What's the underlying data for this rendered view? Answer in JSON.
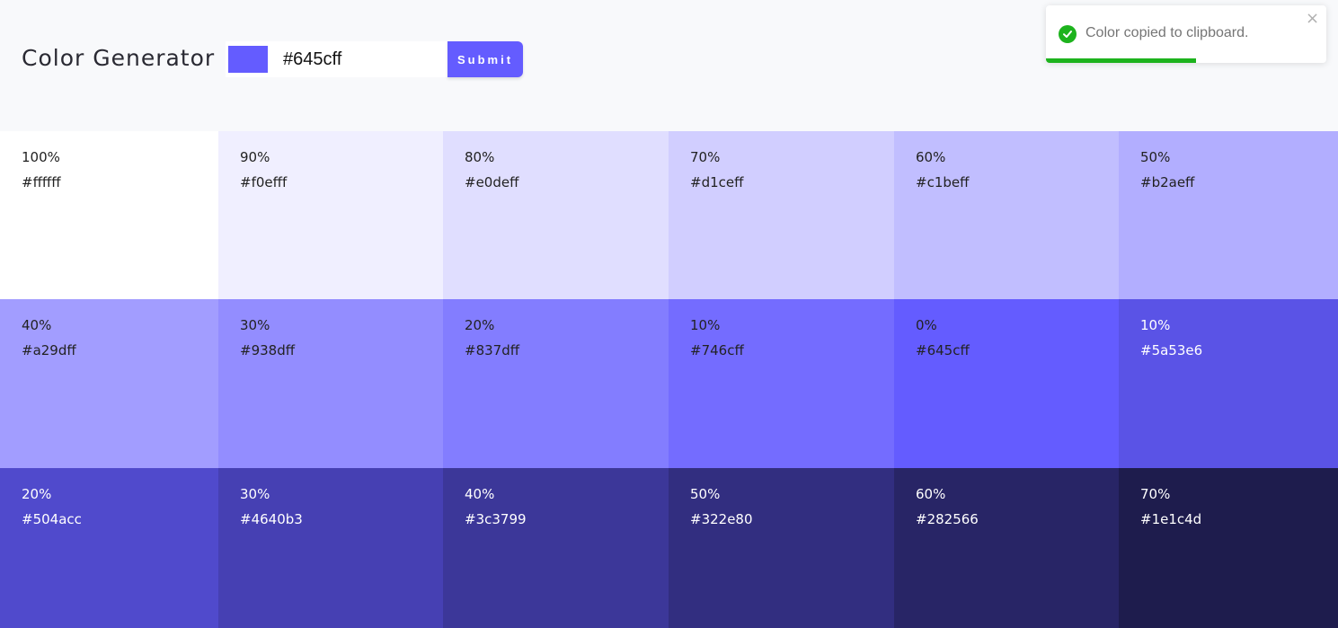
{
  "header": {
    "title": "Color Generator",
    "picker_color": "#645cff",
    "input_value": "#645cff",
    "submit_label": "Submit",
    "accent_color": "#645cff"
  },
  "toast": {
    "message": "Color copied to clipboard.",
    "icon": "check-circle-icon",
    "close_glyph": "×",
    "success_color": "#1db31d",
    "progress_fraction": 0.535
  },
  "colors": [
    {
      "percent": "100%",
      "hex": "#ffffff"
    },
    {
      "percent": "90%",
      "hex": "#f0efff"
    },
    {
      "percent": "80%",
      "hex": "#e0deff"
    },
    {
      "percent": "70%",
      "hex": "#d1ceff"
    },
    {
      "percent": "60%",
      "hex": "#c1beff"
    },
    {
      "percent": "50%",
      "hex": "#b2aeff"
    },
    {
      "percent": "40%",
      "hex": "#a29dff"
    },
    {
      "percent": "30%",
      "hex": "#938dff"
    },
    {
      "percent": "20%",
      "hex": "#837dff"
    },
    {
      "percent": "10%",
      "hex": "#746cff"
    },
    {
      "percent": "0%",
      "hex": "#645cff"
    },
    {
      "percent": "10%",
      "hex": "#5a53e6"
    },
    {
      "percent": "20%",
      "hex": "#504acc"
    },
    {
      "percent": "30%",
      "hex": "#4640b3"
    },
    {
      "percent": "40%",
      "hex": "#3c3799"
    },
    {
      "percent": "50%",
      "hex": "#322e80"
    },
    {
      "percent": "60%",
      "hex": "#282566"
    },
    {
      "percent": "70%",
      "hex": "#1e1c4d"
    }
  ]
}
